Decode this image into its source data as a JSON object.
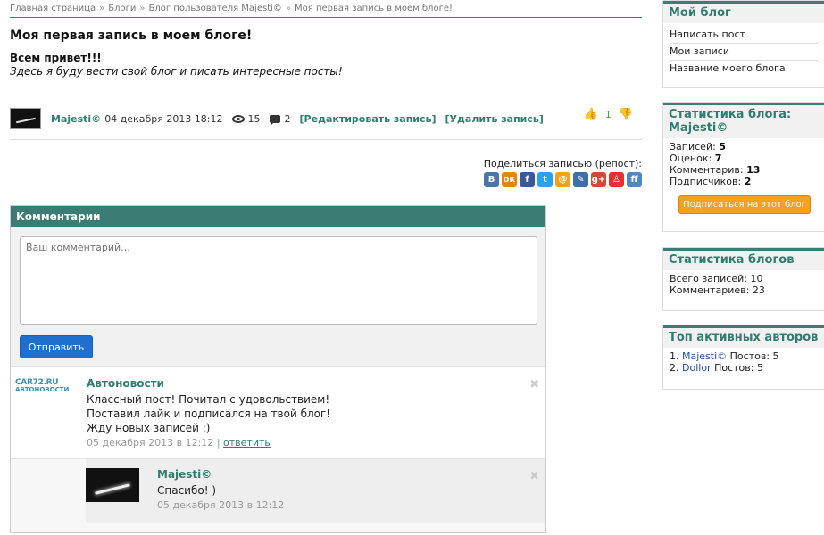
{
  "breadcrumb": [
    "Главная страница",
    "Блоги",
    "Блог пользователя Majesti©",
    "Моя первая запись в моем блоге!"
  ],
  "breadcrumb_separator": "»",
  "post": {
    "title": "Моя первая запись в моем блоге!",
    "greeting": "Всем привет!!!",
    "text": "Здесь я буду вести свой блог  и писать интересные посты!",
    "author": "Majesti©",
    "date": "04 декабря 2013 18:12",
    "views": "15",
    "comments_count": "2",
    "edit_label": "[Редактировать запись]",
    "delete_label": "[Удалить запись]",
    "rating": "1"
  },
  "share": {
    "label": "Поделиться записью (репост):",
    "services": [
      {
        "icon": "vkontakte-icon",
        "glyph": "В",
        "color": "#4a76a8"
      },
      {
        "icon": "odnoklassniki-icon",
        "glyph": "ок",
        "color": "#ee8208"
      },
      {
        "icon": "facebook-icon",
        "glyph": "f",
        "color": "#3b5998"
      },
      {
        "icon": "twitter-icon",
        "glyph": "t",
        "color": "#2aa3ef"
      },
      {
        "icon": "mailru-icon",
        "glyph": "@",
        "color": "#f59f1b"
      },
      {
        "icon": "livejournal-icon",
        "glyph": "✎",
        "color": "#3f6fa8"
      },
      {
        "icon": "google-plus-icon",
        "glyph": "g+",
        "color": "#d34836"
      },
      {
        "icon": "liveinternet-icon",
        "glyph": "♙",
        "color": "#e4322e"
      },
      {
        "icon": "friendfeed-icon",
        "glyph": "ff",
        "color": "#4e86c6"
      }
    ]
  },
  "comments_section": {
    "header": "Комментарии",
    "placeholder": "Ваш комментарий...",
    "submit_label": "Отправить",
    "items": [
      {
        "author": "Автоновости",
        "avatar_text_top": "CAR72.RU",
        "avatar_text_bottom": "АВТОНОВОСТИ",
        "lines": [
          "Классный пост! Почитал с удовольствием!",
          "Поставил лайк и подписался на твой блог!",
          "Жду новых записей :)"
        ],
        "date": "05 декабря 2013 в 12:12",
        "reply_sep": "|",
        "reply_label": "ответить"
      },
      {
        "author": "Majesti©",
        "lines": [
          "Спасибо! )"
        ],
        "date": "05 декабря 2013 в 12:12"
      }
    ],
    "delete_glyph": "✖"
  },
  "sidebar": {
    "my_blog": {
      "title": "Мой блог",
      "links": [
        "Написать пост",
        "Мои записи",
        "Название моего блога"
      ]
    },
    "blog_stats": {
      "title": "Статистика блога: Majesti©",
      "rows": [
        {
          "label": "Записей: ",
          "value": "5"
        },
        {
          "label": "Оценок: ",
          "value": "7"
        },
        {
          "label": "Комментарив: ",
          "value": "13"
        },
        {
          "label": "Подписчиков: ",
          "value": "2"
        }
      ],
      "subscribe_label": "Подписаться на этот блог"
    },
    "blogs_stats": {
      "title": "Статистика блогов",
      "rows": [
        "Всего записей: 10",
        "Комментариев: 23"
      ]
    },
    "top_authors": {
      "title": "Топ активных авторов",
      "items": [
        {
          "rank": "1. ",
          "name": "Majesti©",
          "posts": " Постов: 5"
        },
        {
          "rank": "2. ",
          "name": "Dollor",
          "posts": " Постов: 5"
        }
      ]
    }
  },
  "colors": {
    "accent": "#3b7d74",
    "link_green": "#2f7d6e",
    "button_blue": "#1f6fcf",
    "subscribe_orange": "#f5a020"
  }
}
